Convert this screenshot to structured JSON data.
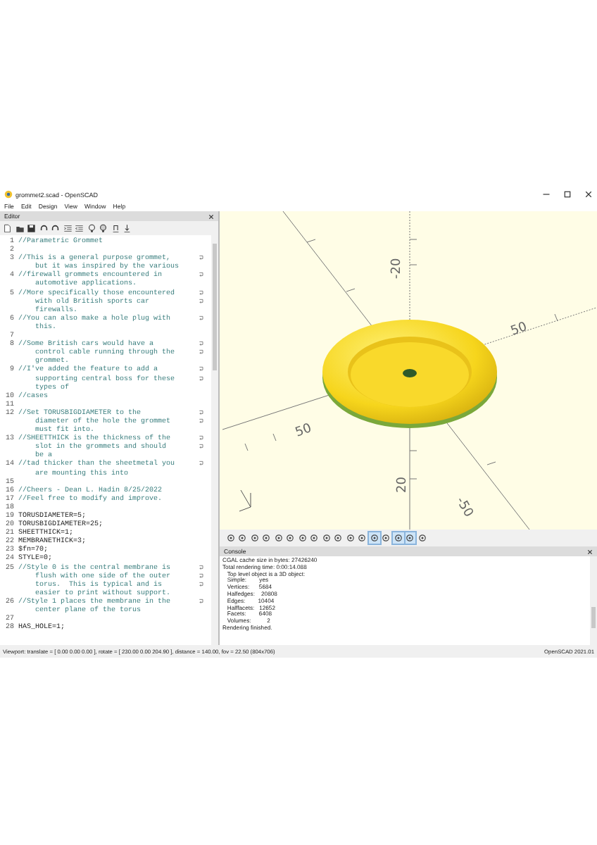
{
  "window": {
    "title": "grommet2.scad - OpenSCAD"
  },
  "menu": [
    "File",
    "Edit",
    "Design",
    "View",
    "Window",
    "Help"
  ],
  "editor": {
    "title": "Editor",
    "lines": [
      {
        "number": "1",
        "kind": "comment",
        "rows": [
          "//Parametric Grommet"
        ]
      },
      {
        "number": "2",
        "kind": "blank"
      },
      {
        "number": "3",
        "kind": "comment",
        "rows": [
          "//This is a general purpose grommet,",
          "but it was inspired by the various"
        ]
      },
      {
        "number": "4",
        "kind": "comment",
        "rows": [
          "//firewall grommets encountered in",
          "automotive applications."
        ]
      },
      {
        "number": "5",
        "kind": "comment",
        "rows": [
          "//More specifically those encountered",
          "with old British sports car",
          "firewalls."
        ]
      },
      {
        "number": "6",
        "kind": "comment",
        "rows": [
          "//You can also make a hole plug with",
          "this."
        ]
      },
      {
        "number": "7",
        "kind": "blank"
      },
      {
        "number": "8",
        "kind": "comment",
        "rows": [
          "//Some British cars would have a",
          "control cable running through the",
          "grommet."
        ]
      },
      {
        "number": "9",
        "kind": "comment",
        "rows": [
          "//I've added the feature to add a",
          "supporting central boss for these",
          "types of"
        ]
      },
      {
        "number": "10",
        "kind": "comment",
        "rows": [
          "//cases"
        ]
      },
      {
        "number": "11",
        "kind": "blank"
      },
      {
        "number": "12",
        "kind": "comment",
        "rows": [
          "//Set TORUSBIGDIAMETER to the",
          "diameter of the hole the grommet",
          "must fit into."
        ]
      },
      {
        "number": "13",
        "kind": "comment",
        "rows": [
          "//SHEETTHICK is the thickness of the",
          "slot in the grommets and should",
          "be a"
        ]
      },
      {
        "number": "14",
        "kind": "comment",
        "rows": [
          "//tad thicker than the sheetmetal you",
          "are mounting this into"
        ]
      },
      {
        "number": "15",
        "kind": "blank"
      },
      {
        "number": "16",
        "kind": "comment",
        "rows": [
          "//Cheers - Dean L. Hadin 8/25/2022"
        ]
      },
      {
        "number": "17",
        "kind": "comment",
        "rows": [
          "//Feel free to modify and improve."
        ]
      },
      {
        "number": "18",
        "kind": "blank"
      },
      {
        "number": "19",
        "kind": "code",
        "rows": [
          "TORUSDIAMETER=5;"
        ]
      },
      {
        "number": "20",
        "kind": "code",
        "rows": [
          "TORUSBIGDIAMETER=25;"
        ]
      },
      {
        "number": "21",
        "kind": "code",
        "rows": [
          "SHEETTHICK=1;"
        ]
      },
      {
        "number": "22",
        "kind": "code",
        "rows": [
          "MEMBRANETHICK=3;"
        ]
      },
      {
        "number": "23",
        "kind": "code",
        "rows": [
          "$fn=70;"
        ]
      },
      {
        "number": "24",
        "kind": "code",
        "rows": [
          "STYLE=0;"
        ]
      },
      {
        "number": "25",
        "kind": "comment",
        "rows": [
          "//Style 0 is the central membrane is",
          "flush with one side of the outer",
          "torus.  This is typical and is",
          "easier to print without support."
        ]
      },
      {
        "number": "26",
        "kind": "comment",
        "rows": [
          "//Style 1 places the membrane in the",
          "center plane of the torus"
        ]
      },
      {
        "number": "27",
        "kind": "blank"
      },
      {
        "number": "28",
        "kind": "code",
        "rows": [
          "HAS_HOLE=1;"
        ]
      }
    ]
  },
  "viewport": {
    "axis_labels": [
      "-20",
      "50",
      "50",
      "20",
      "-50"
    ]
  },
  "viewport_toolbar": [
    {
      "on": false
    },
    {
      "on": false
    },
    {
      "on": false
    },
    {
      "on": false
    },
    {
      "on": false
    },
    {
      "on": false
    },
    {
      "on": false
    },
    {
      "on": false
    },
    {
      "on": false
    },
    {
      "on": false
    },
    {
      "on": false
    },
    {
      "on": false
    },
    {
      "on": true
    },
    {
      "on": false
    },
    {
      "on": true
    },
    {
      "on": true
    },
    {
      "on": false
    }
  ],
  "console": {
    "title": "Console",
    "lines": [
      "CGAL cache size in bytes: 27426240",
      "Total rendering time: 0:00:14.088",
      "   Top level object is a 3D object:",
      "   Simple:        yes",
      "   Vertices:      5684",
      "   Halfedges:    20808",
      "   Edges:        10404",
      "   Halffacets:   12652",
      "   Facets:        6408",
      "   Volumes:          2",
      "Rendering finished."
    ]
  },
  "status_bar": {
    "viewport": "Viewport: translate = [ 0.00 0.00 0.00 ], rotate = [ 230.00 0.00 204.90 ], distance = 140.00, fov = 22.50 (804x706)",
    "version": "OpenSCAD 2021.01"
  }
}
